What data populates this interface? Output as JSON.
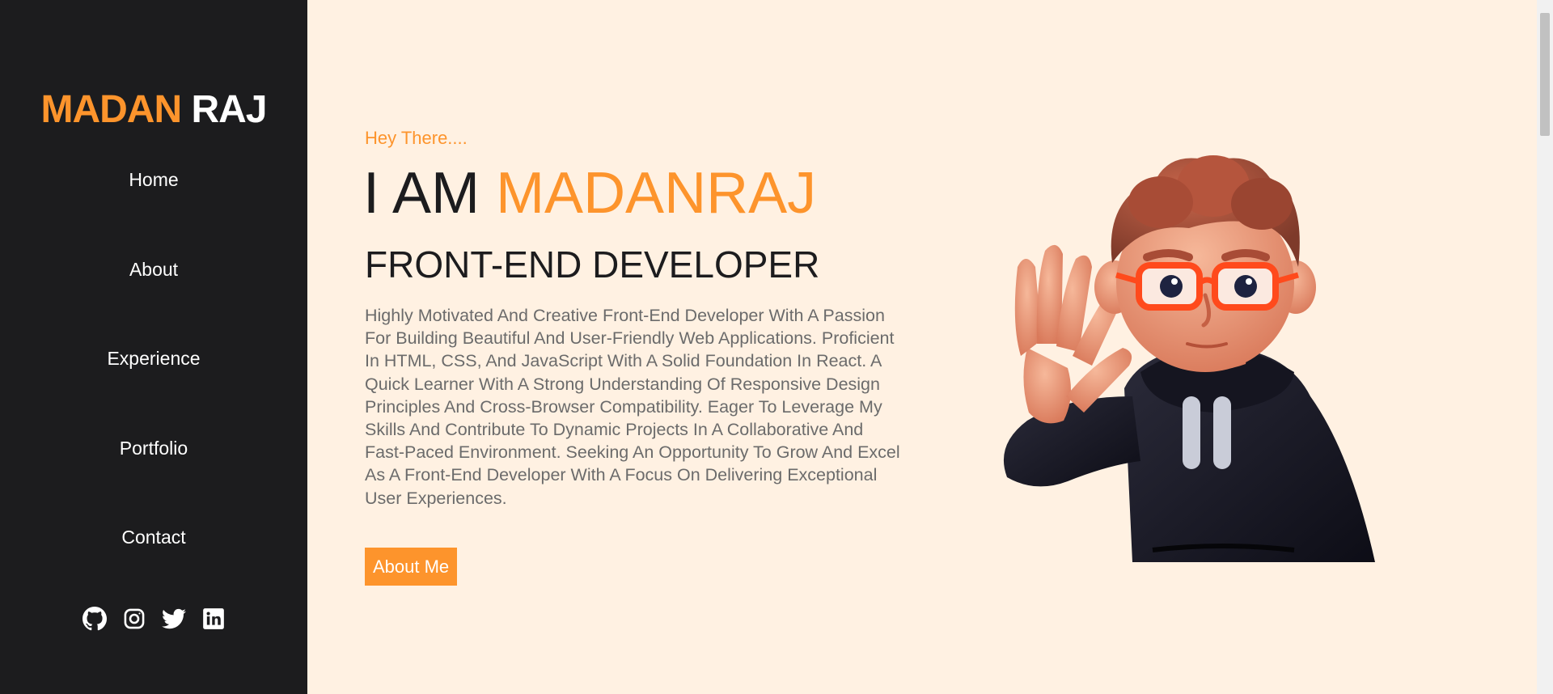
{
  "sidebar": {
    "brand_first": "MADAN",
    "brand_last": "RAJ",
    "nav": [
      {
        "label": "Home"
      },
      {
        "label": "About"
      },
      {
        "label": "Experience"
      },
      {
        "label": "Portfolio"
      },
      {
        "label": "Contact"
      }
    ],
    "socials": [
      "github-icon",
      "instagram-icon",
      "twitter-icon",
      "linkedin-icon"
    ]
  },
  "hero": {
    "greeting": "Hey There....",
    "heading_prefix": "I AM",
    "heading_name": "MADANRAJ",
    "role": "FRONT-END DEVELOPER",
    "bio": "Highly Motivated And Creative Front-End Developer With A Passion For Building Beautiful And User-Friendly Web Applications. Proficient In HTML, CSS, And JavaScript With A Solid Foundation In React. A Quick Learner With A Strong Understanding Of Responsive Design Principles And Cross-Browser Compatibility. Eager To Leverage My Skills And Contribute To Dynamic Projects In A Collaborative And Fast-Paced Environment. Seeking An Opportunity To Grow And Excel As A Front-End Developer With A Focus On Delivering Exceptional User Experiences.",
    "cta_label": "About Me"
  },
  "colors": {
    "accent": "#fd942c",
    "sidebar_bg": "#1c1c1e",
    "page_bg": "#fff1e2",
    "text_dark": "#1c1c1e",
    "text_muted": "#6b6b6b"
  }
}
